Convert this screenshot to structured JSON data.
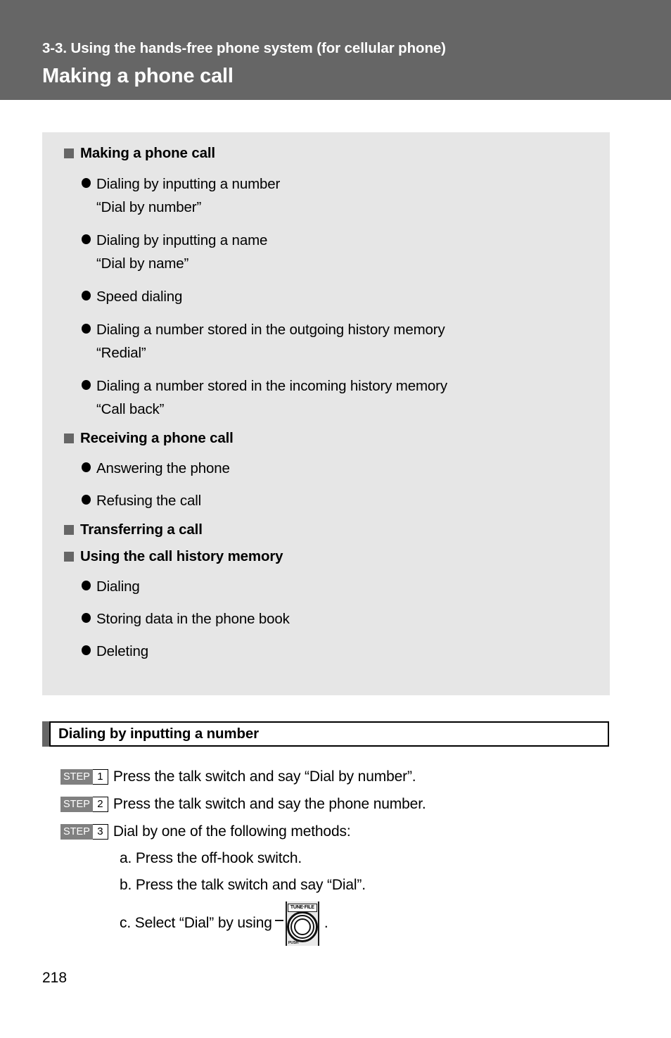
{
  "header": {
    "chapter": "3-3. Using the hands-free phone system (for cellular phone)",
    "title": "Making a phone call"
  },
  "overview": {
    "groups": [
      {
        "heading": "Making a phone call",
        "items": [
          {
            "text": "Dialing by inputting a number",
            "sub": "“Dial by number”"
          },
          {
            "text": "Dialing by inputting a name",
            "sub": "“Dial by name”"
          },
          {
            "text": "Speed dialing",
            "sub": ""
          },
          {
            "text": "Dialing a number stored in the outgoing history memory",
            "sub": "“Redial”"
          },
          {
            "text": "Dialing a number stored in the incoming history memory",
            "sub": "“Call back”"
          }
        ]
      },
      {
        "heading": "Receiving a phone call",
        "items": [
          {
            "text": "Answering the phone",
            "sub": ""
          },
          {
            "text": "Refusing the call",
            "sub": ""
          }
        ]
      },
      {
        "heading": "Transferring a call",
        "items": []
      },
      {
        "heading": "Using the call history memory",
        "items": [
          {
            "text": "Dialing",
            "sub": ""
          },
          {
            "text": "Storing data in the phone book",
            "sub": ""
          },
          {
            "text": "Deleting",
            "sub": ""
          }
        ]
      }
    ]
  },
  "section": {
    "title": "Dialing by inputting a number"
  },
  "steps": [
    {
      "word": "STEP",
      "number": "1",
      "text": "Press the talk switch and say “Dial by number”."
    },
    {
      "word": "STEP",
      "number": "2",
      "text": "Press the talk switch and say the phone number."
    },
    {
      "word": "STEP",
      "number": "3",
      "text": "Dial by one of the following methods:"
    }
  ],
  "methods": [
    {
      "text": "a. Press the off-hook switch."
    },
    {
      "text": "b. Press the talk switch and say “Dial”."
    }
  ],
  "method_c": {
    "lead_text": "c. Select “Dial” by using",
    "trail_text": ".",
    "icon": {
      "top_label": "TUNE·FILE",
      "bottom_label": "PUSH"
    }
  },
  "page_number": "218",
  "colors": {
    "header_band": "#666666",
    "panel_background": "#e6e6e6",
    "square_bullet": "#666666",
    "step_badge": "#808080",
    "text": "#000000"
  }
}
